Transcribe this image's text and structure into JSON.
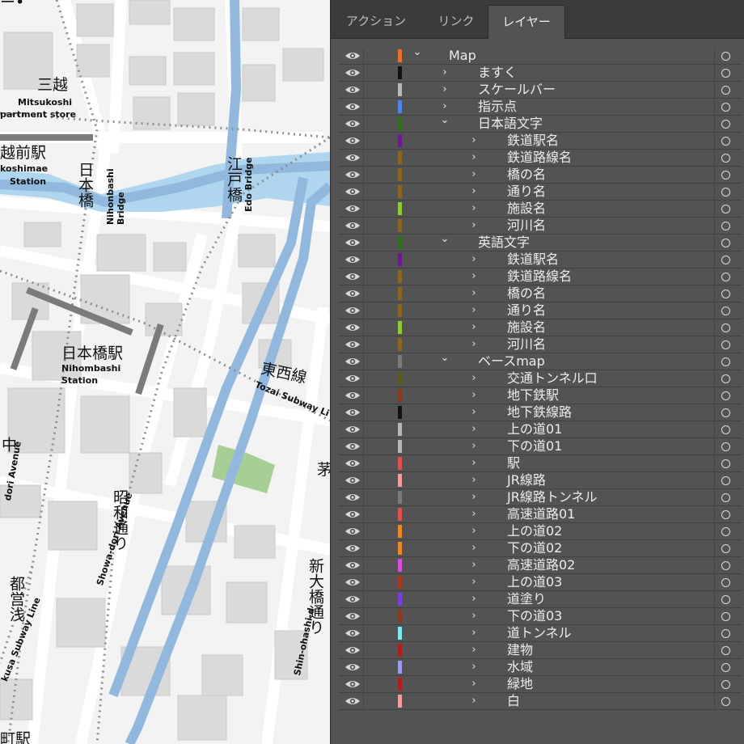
{
  "panel": {
    "tabs": [
      {
        "label": "アクション",
        "active": false
      },
      {
        "label": "リンク",
        "active": false
      },
      {
        "label": "レイヤー",
        "active": true
      }
    ],
    "layers": [
      {
        "name": "Map",
        "level": 0,
        "expanded": true,
        "color": "#e8702a"
      },
      {
        "name": "ますく",
        "level": 1,
        "expanded": false,
        "color": "#111111"
      },
      {
        "name": "スケールバー",
        "level": 1,
        "expanded": false,
        "color": "#b8b8b8"
      },
      {
        "name": "指示点",
        "level": 1,
        "expanded": false,
        "color": "#4e86e6"
      },
      {
        "name": "日本語文字",
        "level": 1,
        "expanded": true,
        "color": "#2f6e1c"
      },
      {
        "name": "鉄道駅名",
        "level": 2,
        "expanded": false,
        "color": "#6a1d8a"
      },
      {
        "name": "鉄道路線名",
        "level": 2,
        "expanded": false,
        "color": "#8a6524"
      },
      {
        "name": "橋の名",
        "level": 2,
        "expanded": false,
        "color": "#8a6524"
      },
      {
        "name": "通り名",
        "level": 2,
        "expanded": false,
        "color": "#8a6524"
      },
      {
        "name": "施設名",
        "level": 2,
        "expanded": false,
        "color": "#8fc93a"
      },
      {
        "name": "河川名",
        "level": 2,
        "expanded": false,
        "color": "#8a6524"
      },
      {
        "name": "英語文字",
        "level": 1,
        "expanded": true,
        "color": "#2f6e1c"
      },
      {
        "name": "鉄道駅名",
        "level": 2,
        "expanded": false,
        "color": "#6a1d8a"
      },
      {
        "name": "鉄道路線名",
        "level": 2,
        "expanded": false,
        "color": "#8a6524"
      },
      {
        "name": "橋の名",
        "level": 2,
        "expanded": false,
        "color": "#8a6524"
      },
      {
        "name": "通り名",
        "level": 2,
        "expanded": false,
        "color": "#8a6524"
      },
      {
        "name": "施設名",
        "level": 2,
        "expanded": false,
        "color": "#8fc93a"
      },
      {
        "name": "河川名",
        "level": 2,
        "expanded": false,
        "color": "#8a6524"
      },
      {
        "name": "ベースmap",
        "level": 1,
        "expanded": true,
        "color": "#7a7a7a"
      },
      {
        "name": "交通トンネル口",
        "level": 2,
        "expanded": false,
        "color": "#5e5a1e"
      },
      {
        "name": "地下鉄駅",
        "level": 2,
        "expanded": false,
        "color": "#8a3a1c"
      },
      {
        "name": "地下鉄線路",
        "level": 2,
        "expanded": false,
        "color": "#111111"
      },
      {
        "name": "上の道01",
        "level": 2,
        "expanded": false,
        "color": "#b8b8b8"
      },
      {
        "name": "下の道01",
        "level": 2,
        "expanded": false,
        "color": "#b8b8b8"
      },
      {
        "name": "駅",
        "level": 2,
        "expanded": false,
        "color": "#e05252"
      },
      {
        "name": "JR線路",
        "level": 2,
        "expanded": false,
        "color": "#f0a0a0"
      },
      {
        "name": "JR線路トンネル",
        "level": 2,
        "expanded": false,
        "color": "#7a7a7a"
      },
      {
        "name": "高速道路01",
        "level": 2,
        "expanded": false,
        "color": "#e05252"
      },
      {
        "name": "上の道02",
        "level": 2,
        "expanded": false,
        "color": "#e88a2a"
      },
      {
        "name": "下の道02",
        "level": 2,
        "expanded": false,
        "color": "#e88a2a"
      },
      {
        "name": "高速道路02",
        "level": 2,
        "expanded": false,
        "color": "#d94fd9"
      },
      {
        "name": "上の道03",
        "level": 2,
        "expanded": false,
        "color": "#a33a1c"
      },
      {
        "name": "道塗り",
        "level": 2,
        "expanded": false,
        "color": "#7a3fe0"
      },
      {
        "name": "下の道03",
        "level": 2,
        "expanded": false,
        "color": "#8a3a1c"
      },
      {
        "name": "道トンネル",
        "level": 2,
        "expanded": false,
        "color": "#7fe8f0"
      },
      {
        "name": "建物",
        "level": 2,
        "expanded": false,
        "color": "#b01e1e"
      },
      {
        "name": "水域",
        "level": 2,
        "expanded": false,
        "color": "#9a9aee"
      },
      {
        "name": "緑地",
        "level": 2,
        "expanded": false,
        "color": "#b01e1e"
      },
      {
        "name": "白",
        "level": 2,
        "expanded": false,
        "color": "#f0a0a0"
      }
    ]
  },
  "map": {
    "labels": {
      "top_fragment": "ー•",
      "mitsukoshi_jp": "三越",
      "mitsukoshi_en": "Mitsukoshi",
      "dept_store_en": "partment store",
      "mae_station_jp": "越前駅",
      "mae_station_en1": "koshimae",
      "mae_station_en2": "Station",
      "nihonbashi_jp": "日本橋",
      "nihonbashi_bridge_en": "Nihonbashi Bridge",
      "edo_jp": "江戸橋",
      "edo_bridge_en": "Edo Bridge",
      "nihonbashi_station_jp": "日本橋駅",
      "nihonbashi_station_en1": "Nihombashi",
      "nihonbashi_station_en2": "Station",
      "tozai_jp": "東西線",
      "tozai_en": "Tozai Subway Li",
      "chuo_jp": "中",
      "chuo_en": "dori Avenue",
      "showa_jp": "昭和通り",
      "showa_en": "Showa-dori Avenue",
      "shinohashi_jp": "新大橋通り",
      "shinohashi_en": "Shin-ohashi-d",
      "asakusa_jp": "都営浅",
      "asakusa_en": "kusa Subway Line",
      "kaya_jp": "茅",
      "bottom_jp": "町駅"
    }
  }
}
